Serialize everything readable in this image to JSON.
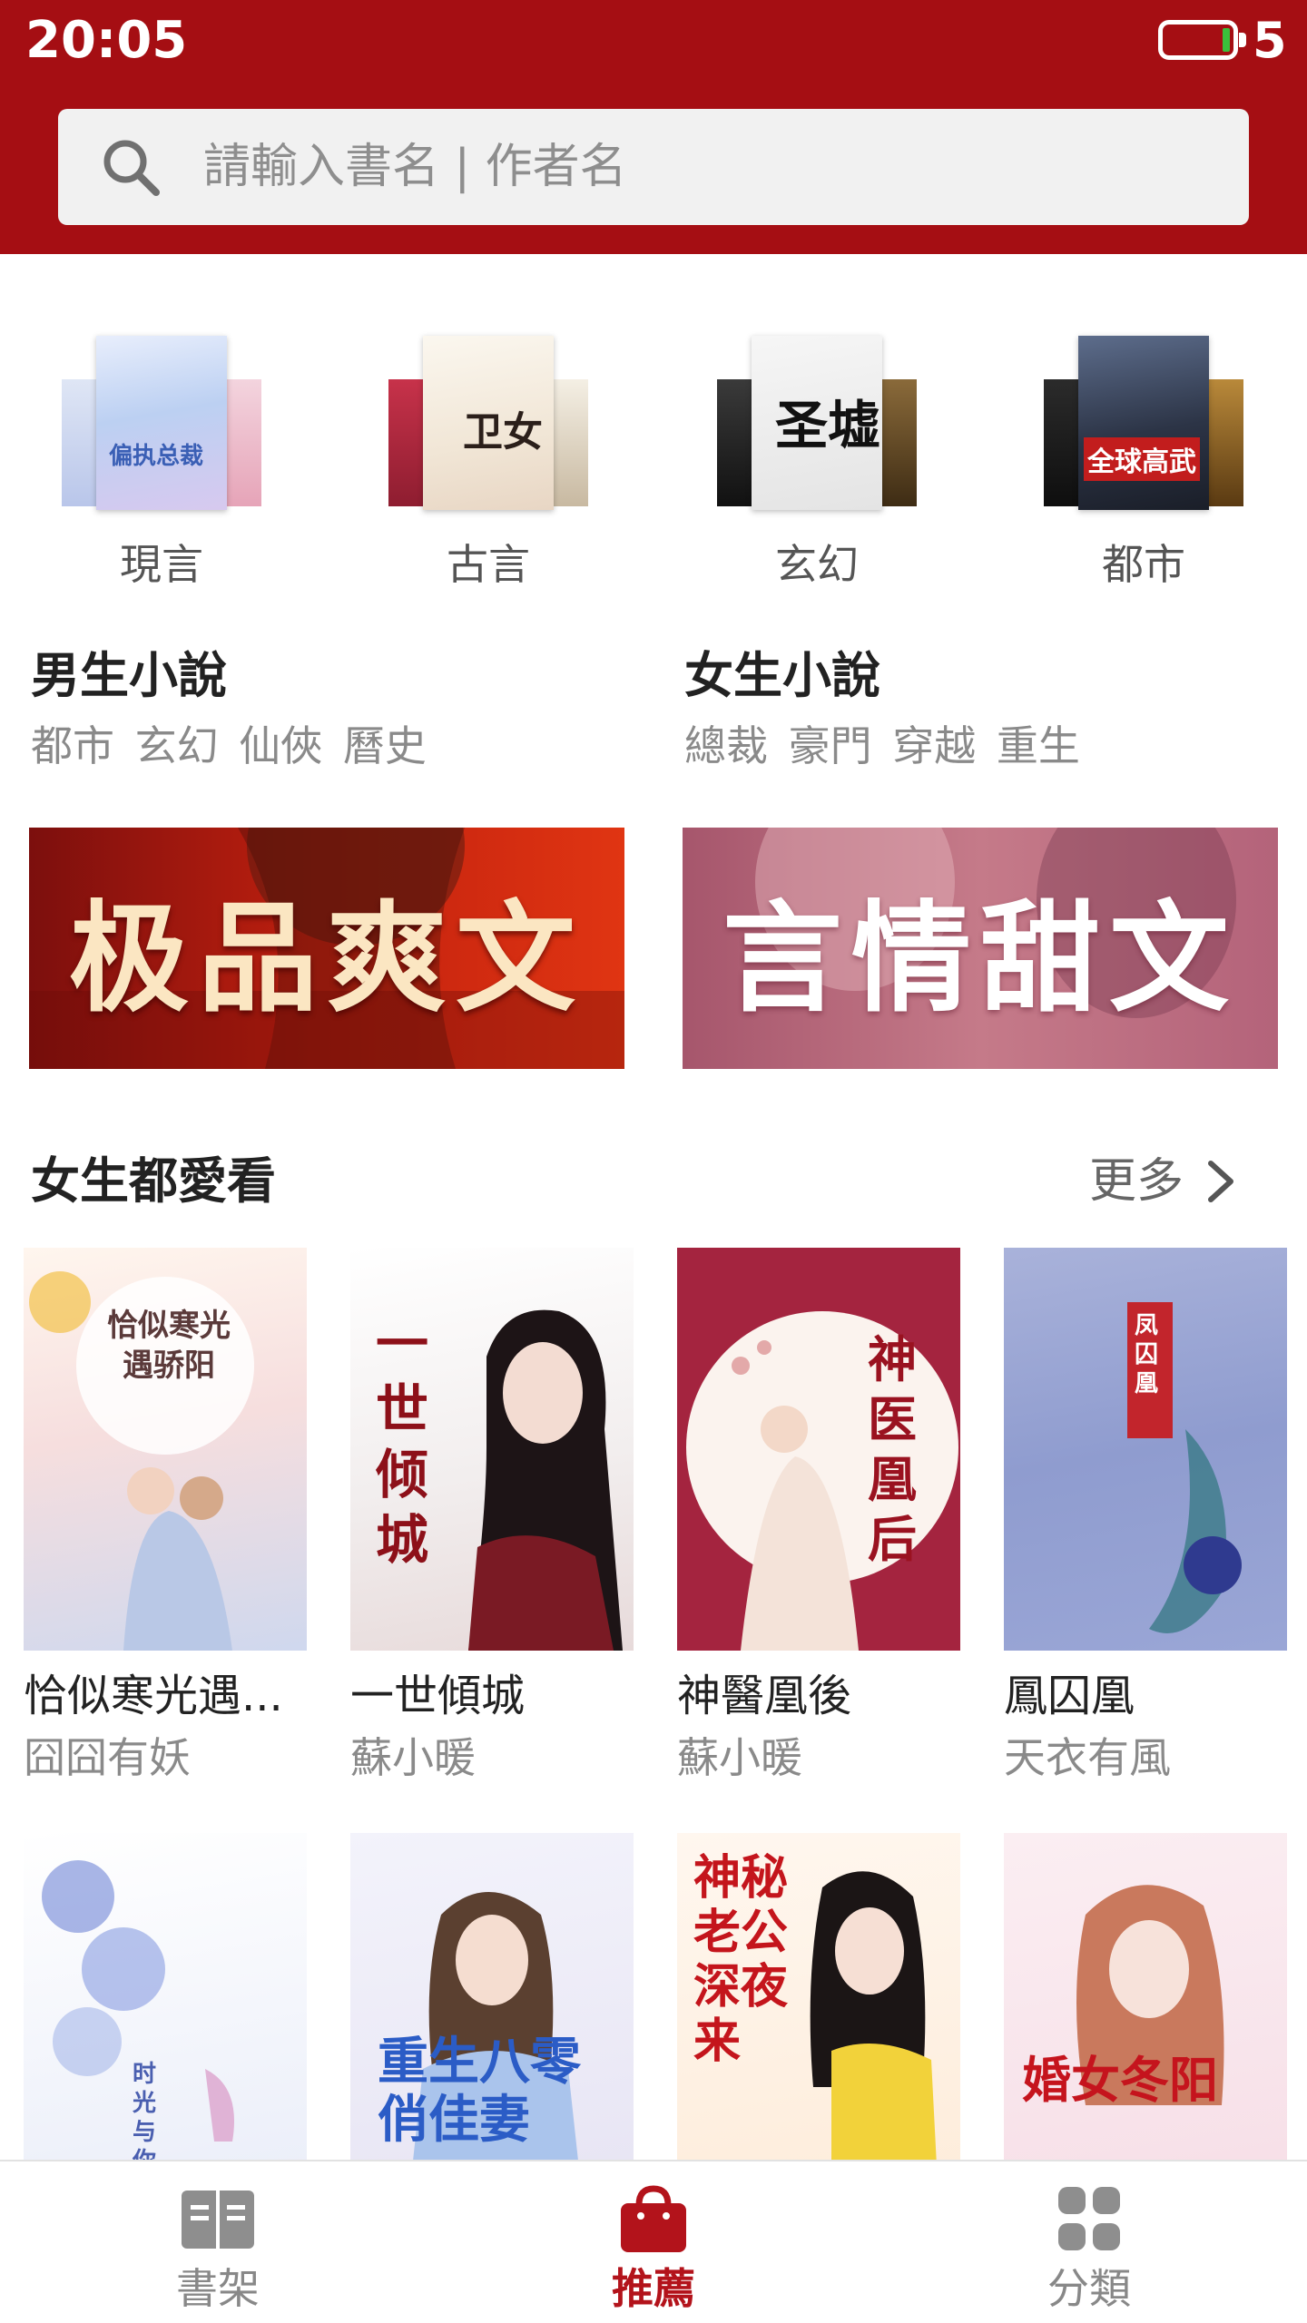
{
  "status_bar": {
    "time": "20:05",
    "battery_level": "5"
  },
  "search": {
    "placeholder": "請輸入書名 | 作者名"
  },
  "categories": [
    {
      "label": "現言",
      "cover_text": "偏执总裁"
    },
    {
      "label": "古言",
      "cover_text": "卫女"
    },
    {
      "label": "玄幻",
      "cover_text": "圣墟"
    },
    {
      "label": "都市",
      "cover_text": "全球高武"
    }
  ],
  "male_section": {
    "title": "男生小說",
    "tags": "都市 玄幻 仙俠 曆史"
  },
  "female_section": {
    "title": "女生小說",
    "tags": "總裁 豪門 穿越 重生"
  },
  "banners": [
    {
      "text": "极品爽文"
    },
    {
      "text": "言情甜文"
    }
  ],
  "featured": {
    "title": "女生都愛看",
    "more_label": "更多",
    "books": [
      {
        "title": "恰似寒光遇...",
        "author": "囧囧有妖",
        "cover_text": "恰似寒光遇骄阳"
      },
      {
        "title": "一世傾城",
        "author": "蘇小暖",
        "cover_text": "一世倾城"
      },
      {
        "title": "神醫凰後",
        "author": "蘇小暖",
        "cover_text": "神医凰后"
      },
      {
        "title": "鳳囚凰",
        "author": "天衣有風",
        "cover_text": "凤囚凰"
      }
    ],
    "row2_covers": [
      {
        "cover_text": "时光与你共缠"
      },
      {
        "cover_text": "重生八零俏佳妻"
      },
      {
        "cover_text": "神秘老公深夜来"
      },
      {
        "cover_text": "婚女冬阳"
      }
    ]
  },
  "bottom_nav": [
    {
      "label": "書架",
      "active": false
    },
    {
      "label": "推薦",
      "active": true
    },
    {
      "label": "分類",
      "active": false
    }
  ],
  "colors": {
    "brand_red": "#a50e13",
    "active_red": "#b3131b"
  }
}
